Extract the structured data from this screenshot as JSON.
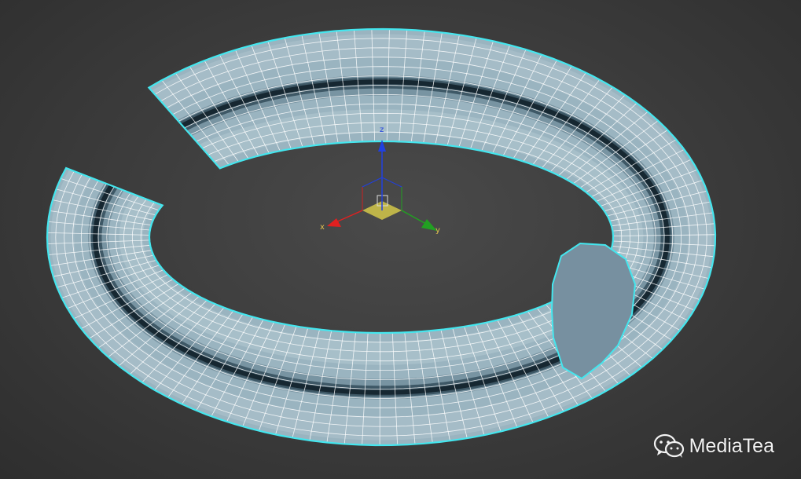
{
  "viewport": {
    "background": "#3a3a3a",
    "object": {
      "name": "torus-segment",
      "shading_color": "#9ab4c0",
      "wire_color": "#ffffff",
      "selection_outline_color": "#44e6ee"
    },
    "gizmo": {
      "axes": [
        {
          "id": "x",
          "label": "x",
          "color": "#e02020"
        },
        {
          "id": "y",
          "label": "y",
          "color": "#22a022"
        },
        {
          "id": "z",
          "label": "z",
          "color": "#2040e0"
        }
      ],
      "plane_highlight_color": "#e6d84a"
    }
  },
  "watermark": {
    "icon": "wechat-icon",
    "text": "MediaTea"
  }
}
